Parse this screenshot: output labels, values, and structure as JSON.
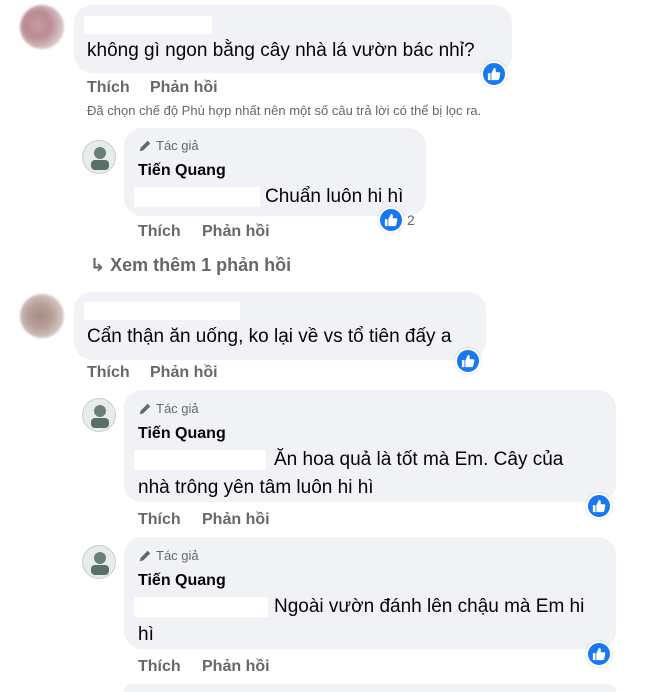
{
  "comments": [
    {
      "text": "không gì ngon bằng cây nhà lá vườn bác nhỉ?",
      "actions": {
        "like": "Thích",
        "reply": "Phản hồi"
      }
    },
    {
      "text": "Cẩn thận ăn uống, ko lại về vs tổ tiên đấy a",
      "actions": {
        "like": "Thích",
        "reply": "Phản hồi"
      }
    }
  ],
  "filter_note": "Đã chọn chế độ Phù hợp nhất nên một số câu trả lời có thể bị lọc ra.",
  "replies": [
    {
      "tag": "Tác giả",
      "author": "Tiến Quang",
      "text": "Chuẩn luôn hi hì",
      "reaction_count": "2",
      "actions": {
        "like": "Thích",
        "reply": "Phản hồi"
      }
    },
    {
      "tag": "Tác giả",
      "author": "Tiến Quang",
      "text_line1": "Ăn hoa quả là tốt mà Em. Cây của",
      "text_line2": "nhà trông yên tâm luôn hi hì",
      "actions": {
        "like": "Thích",
        "reply": "Phản hồi"
      }
    },
    {
      "tag": "Tác giả",
      "author": "Tiến Quang",
      "text_line1": "Ngoài vườn đánh lên chậu mà Em hi",
      "text_line2": "hì",
      "actions": {
        "like": "Thích",
        "reply": "Phản hồi"
      }
    }
  ],
  "view_more": "Xem thêm 1 phản hồi",
  "icons": {
    "reaction": "like-icon",
    "author_badge": "pencil-icon",
    "reply_arrow": "reply-arrow-icon"
  },
  "colors": {
    "bubble": "#f0f2f5",
    "like": "#1877f2",
    "secondary_text": "#65676b"
  }
}
